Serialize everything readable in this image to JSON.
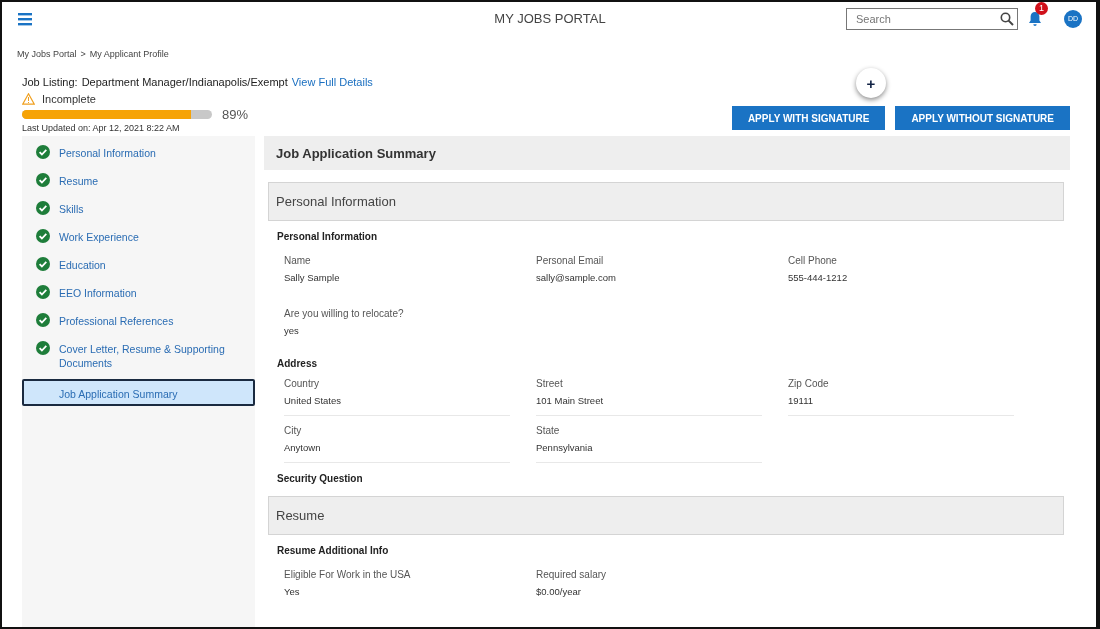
{
  "header": {
    "title": "MY JOBS PORTAL",
    "search": {
      "placeholder": "Search"
    },
    "notifications": "1",
    "avatar": "DD"
  },
  "breadcrumb": [
    "My Jobs Portal",
    "My Applicant Profile"
  ],
  "breadcrumb_separator": ">",
  "job": {
    "label": "Job Listing:",
    "value": "Department Manager/Indianapolis/Exempt",
    "link": "View Full Details"
  },
  "status": {
    "text": "Incomplete",
    "level": 0.89,
    "percent": "89%",
    "updated": "Last Updated on: Apr 12, 2021 8:22 AM"
  },
  "add_button": "+",
  "actions": [
    "APPLY WITH SIGNATURE",
    "APPLY WITHOUT SIGNATURE"
  ],
  "steps": [
    {
      "label": "Personal Information",
      "complete": true,
      "selected": false
    },
    {
      "label": "Resume",
      "complete": true,
      "selected": false
    },
    {
      "label": "Skills",
      "complete": true,
      "selected": false
    },
    {
      "label": "Work Experience",
      "complete": true,
      "selected": false
    },
    {
      "label": "Education",
      "complete": true,
      "selected": false
    },
    {
      "label": "EEO Information",
      "complete": true,
      "selected": false
    },
    {
      "label": "Professional References",
      "complete": true,
      "selected": false
    },
    {
      "label": "Cover Letter, Resume & Supporting Documents",
      "complete": true,
      "selected": false
    },
    {
      "label": "Job Application Summary",
      "complete": false,
      "selected": true
    }
  ],
  "summary_title": "Job Application Summary",
  "sections": [
    {
      "title": "Personal Information",
      "groups": [
        {
          "heading": "Personal Information",
          "kind": "plain",
          "rows": [
            [
              {
                "label": "Name",
                "value": "Sally Sample"
              },
              {
                "label": "Personal Email",
                "value": "sally@sample.com"
              },
              {
                "label": "Cell Phone",
                "value": "555-444-1212"
              }
            ],
            [
              {
                "label": "Are you willing to relocate?",
                "value": "yes"
              }
            ]
          ]
        },
        {
          "heading": "Address",
          "kind": "lined",
          "rows": [
            [
              {
                "label": "Country",
                "value": "United States"
              },
              {
                "label": "Street",
                "value": "101 Main Street"
              },
              {
                "label": "Zip Code",
                "value": "19111"
              }
            ],
            [
              {
                "label": "City",
                "value": "Anytown"
              },
              {
                "label": "State",
                "value": "Pennsylvania"
              }
            ]
          ]
        },
        {
          "heading": "Security Question",
          "kind": "plain"
        }
      ]
    },
    {
      "title": "Resume",
      "groups": [
        {
          "heading": "Resume Additional Info",
          "kind": "plain",
          "rows": [
            [
              {
                "label": "Eligible For Work in the USA",
                "value": "Yes"
              },
              {
                "label": "Required salary",
                "value": "$0.00/year"
              }
            ]
          ]
        }
      ]
    }
  ]
}
